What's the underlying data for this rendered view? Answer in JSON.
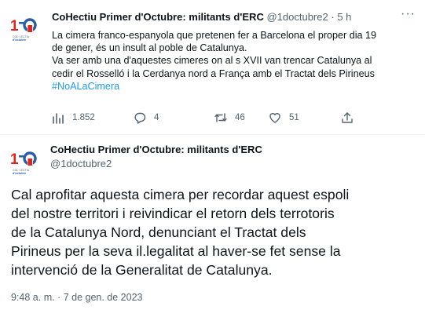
{
  "tweet1": {
    "author_name": "CoHectiu Primer d'Octubre: militants d'ERC",
    "handle": "@1doctubre2",
    "separator": "·",
    "time": "5 h",
    "more": "···",
    "text_lines": [
      "La cimera franco-espanyola que pretenen fer a Barcelona el proper dia 19",
      "de gener, és un insult al poble de Catalunya.",
      "Va ser amb una d'aquestes cimeres on al s XVII van trencar Catalunya al",
      "cedir el Rosselló i la Cerdanya nord a França amb el Tractat dels Pirineus"
    ],
    "hashtag": "#NoALaCimera",
    "views": "1.852",
    "replies": "4",
    "retweets": "46",
    "likes": "51"
  },
  "tweet2": {
    "author_name": "CoHectiu Primer d'Octubre: militants d'ERC",
    "handle": "@1doctubre2",
    "text_lines": [
      "Cal aprofitar aquesta cimera per recordar aquest espoli",
      "del nostre territori i reivindicar el retorn dels terrotoris",
      "de la Catalunya Nord, denunciant el Tractat dels",
      "Pirineus per la seva il.legalitat al haver-se fet sense la",
      "intervenció de la Generalitat de Catalunya."
    ],
    "timestamp": "9:48 a. m. · 7 de gen. de 2023"
  },
  "avatar_logo": {
    "mark": "1-0",
    "caption": "COL·LECTIU 1 d'octubre"
  },
  "colors": {
    "text": "#0f1419",
    "secondary": "#536471",
    "link": "#1d9bf0",
    "logo_red": "#e2231a",
    "logo_blue": "#2a5caa",
    "divider": "#eff3f4"
  },
  "icons": [
    "views-icon",
    "reply-icon",
    "retweet-icon",
    "like-icon",
    "share-icon",
    "more-icon"
  ]
}
